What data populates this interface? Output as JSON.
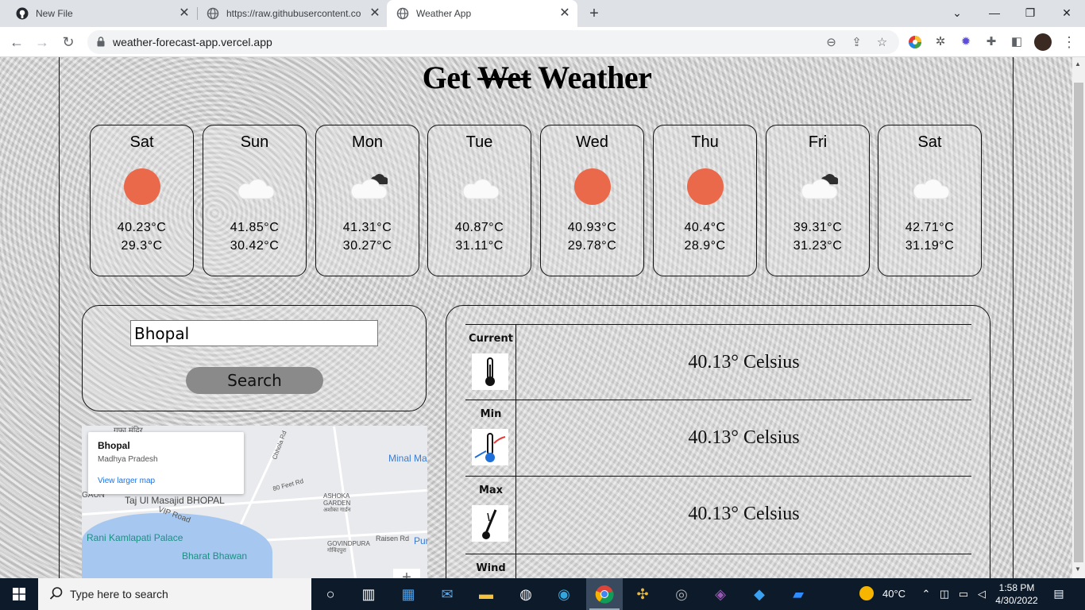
{
  "browser": {
    "tabs": [
      {
        "title": "New File",
        "icon": "github-icon"
      },
      {
        "title": "https://raw.githubusercontent.co",
        "icon": "globe-icon"
      },
      {
        "title": "Weather App",
        "icon": "globe-icon",
        "active": true
      }
    ],
    "url": "weather-forecast-app.vercel.app"
  },
  "app": {
    "title_prefix": "Get",
    "title_strike": "Wet",
    "title_suffix": "Weather",
    "forecast": [
      {
        "day": "Sat",
        "icon": "sun-icon",
        "hi": "40.23°C",
        "lo": "29.3°C"
      },
      {
        "day": "Sun",
        "icon": "cloud-icon",
        "hi": "41.85°C",
        "lo": "30.42°C"
      },
      {
        "day": "Mon",
        "icon": "cloud-dark-icon",
        "hi": "41.31°C",
        "lo": "30.27°C"
      },
      {
        "day": "Tue",
        "icon": "cloud-icon",
        "hi": "40.87°C",
        "lo": "31.11°C"
      },
      {
        "day": "Wed",
        "icon": "sun-icon",
        "hi": "40.93°C",
        "lo": "29.78°C"
      },
      {
        "day": "Thu",
        "icon": "sun-icon",
        "hi": "40.4°C",
        "lo": "28.9°C"
      },
      {
        "day": "Fri",
        "icon": "cloud-dark-icon",
        "hi": "39.31°C",
        "lo": "31.23°C"
      },
      {
        "day": "Sat",
        "icon": "cloud-icon",
        "hi": "42.71°C",
        "lo": "31.19°C"
      }
    ],
    "search": {
      "value": "Bhopal",
      "button": "Search"
    },
    "map": {
      "place": "Bhopal",
      "region": "Madhya Pradesh",
      "link": "View larger map",
      "labels": [
        "Taj Ul Masajid BHOPAL",
        "Rani Kamlapati Palace",
        "Bharat Bhawan",
        "Minal Ma",
        "ASHOKA GARDEN",
        "GOVINDPURA",
        "Raisen Rd",
        "80 Feet Rd",
        "Chhola Rd",
        "VIP Road",
        "Pur",
        "GAUN",
        "गुफा मंदिर",
        "अशोका गार्डन",
        "गोविंदपुरा"
      ]
    },
    "details": [
      {
        "label": "Current",
        "icon": "thermometer-icon",
        "value": "40.13° Celsius"
      },
      {
        "label": "Min",
        "icon": "min-thermometer-icon",
        "value": "40.13° Celsius"
      },
      {
        "label": "Max",
        "icon": "max-thermometer-icon",
        "value": "40.13° Celsius"
      },
      {
        "label": "Wind",
        "icon": "wind-icon",
        "value": ""
      }
    ]
  },
  "taskbar": {
    "search_placeholder": "Type here to search",
    "weather": "40°C",
    "time": "1:58 PM",
    "date": "4/30/2022"
  }
}
